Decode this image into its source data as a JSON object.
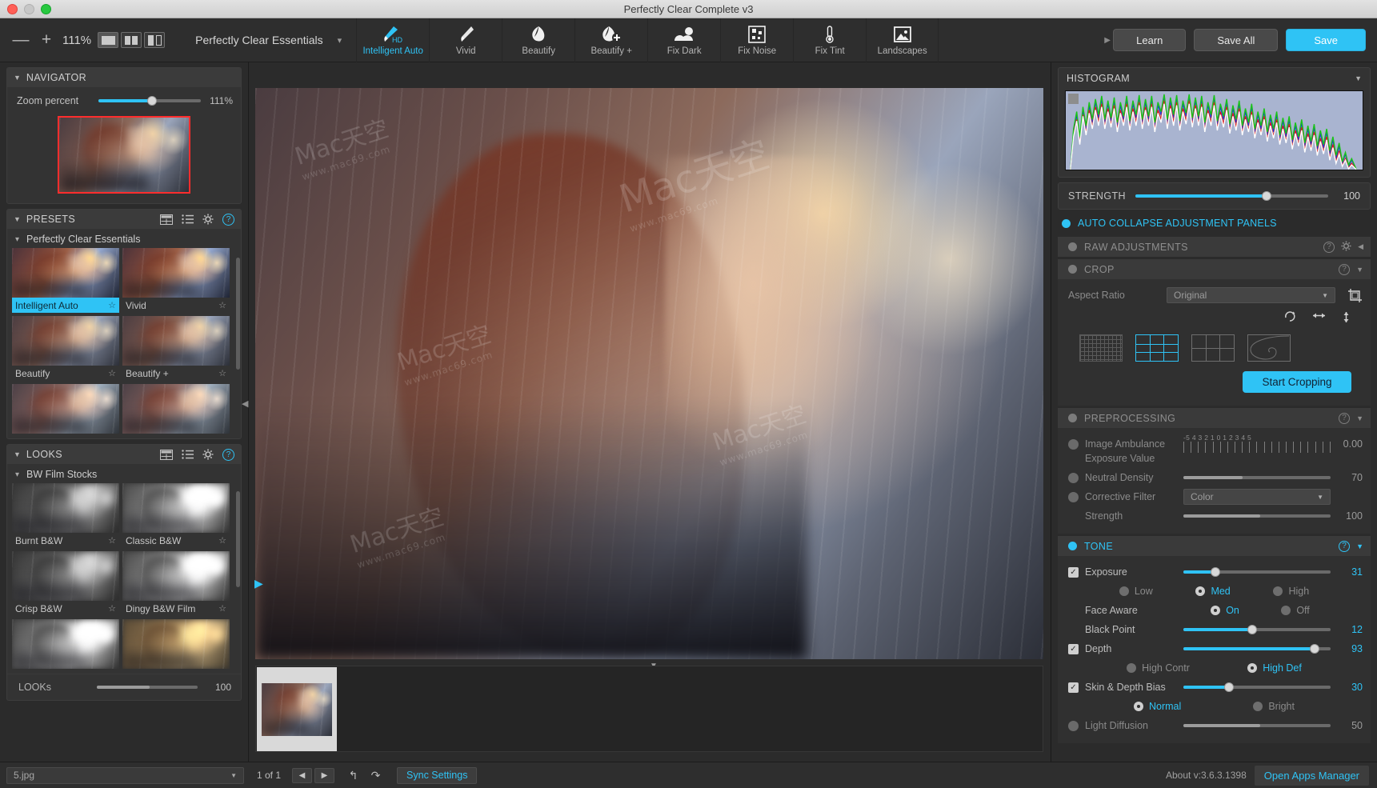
{
  "window": {
    "title": "Perfectly Clear Complete v3"
  },
  "toolbar": {
    "zoom_out": "—",
    "zoom_in": "+",
    "zoom_percent": "111%",
    "preset_name": "Perfectly Clear Essentials",
    "tools": [
      {
        "label": "Intelligent Auto",
        "icon": "brush-hd-icon",
        "badge": "HD",
        "active": true
      },
      {
        "label": "Vivid",
        "icon": "brush-icon",
        "active": false
      },
      {
        "label": "Beautify",
        "icon": "face-icon",
        "active": false
      },
      {
        "label": "Beautify +",
        "icon": "face-plus-icon",
        "active": false
      },
      {
        "label": "Fix Dark",
        "icon": "clouds-icon",
        "active": false
      },
      {
        "label": "Fix Noise",
        "icon": "noise-icon",
        "active": false
      },
      {
        "label": "Fix Tint",
        "icon": "thermometer-icon",
        "active": false
      },
      {
        "label": "Landscapes",
        "icon": "landscape-icon",
        "active": false
      }
    ],
    "learn_label": "Learn",
    "save_all_label": "Save All",
    "save_label": "Save"
  },
  "navigator": {
    "title": "NAVIGATOR",
    "zoom_label": "Zoom percent",
    "zoom_value": "111%"
  },
  "presets": {
    "title": "PRESETS",
    "group": "Perfectly Clear Essentials",
    "items": [
      {
        "label": "Intelligent Auto",
        "selected": true,
        "style": "vivid"
      },
      {
        "label": "Vivid",
        "selected": false,
        "style": "vivid"
      },
      {
        "label": "Beautify",
        "selected": false,
        "style": ""
      },
      {
        "label": "Beautify +",
        "selected": false,
        "style": ""
      },
      {
        "label": "",
        "selected": false,
        "style": "cool"
      },
      {
        "label": "",
        "selected": false,
        "style": "cool"
      }
    ]
  },
  "looks": {
    "title": "LOOKS",
    "group": "BW Film Stocks",
    "items": [
      {
        "label": "Burnt B&W",
        "style": "bw"
      },
      {
        "label": "Classic B&W",
        "style": "bw2"
      },
      {
        "label": "Crisp B&W",
        "style": "bw2"
      },
      {
        "label": "Dingy B&W Film",
        "style": "sepia"
      },
      {
        "label": "",
        "style": "bw2"
      },
      {
        "label": "",
        "style": "sepia"
      }
    ],
    "footer_label": "LOOKs",
    "footer_value": "100"
  },
  "histogram": {
    "title": "HISTOGRAM"
  },
  "strength": {
    "label": "STRENGTH",
    "value": "100"
  },
  "auto_collapse": {
    "label": "AUTO COLLAPSE ADJUSTMENT PANELS"
  },
  "panels": {
    "raw_adjustments": {
      "title": "RAW ADJUSTMENTS",
      "enabled": false
    },
    "crop": {
      "title": "CROP",
      "enabled": false,
      "aspect_ratio_label": "Aspect Ratio",
      "aspect_ratio_value": "Original",
      "start_cropping_label": "Start Cropping",
      "icons": [
        "rotate-icon",
        "flip-horizontal-icon",
        "flip-vertical-icon"
      ],
      "overlays": [
        "grid-dense-icon",
        "grid-thirds-icon",
        "grid-quarters-icon",
        "golden-spiral-icon"
      ],
      "selected_overlay": 1
    },
    "preprocessing": {
      "title": "PREPROCESSING",
      "enabled": false,
      "rows": [
        {
          "name": "Image Ambulance",
          "type": "checkbox",
          "checked": false
        },
        {
          "name": "Exposure Value",
          "type": "ticks",
          "scale": "-5  4  3  2  1  0  1  2  3  4  5",
          "value": "0.00"
        },
        {
          "name": "Neutral Density",
          "type": "slider",
          "checked": false,
          "value": "70",
          "fill": 0.4
        },
        {
          "name": "Corrective Filter",
          "type": "select",
          "checked": false,
          "value": "Color"
        },
        {
          "name": "Strength",
          "type": "slider",
          "checked": null,
          "value": "100",
          "fill": 0.52
        }
      ]
    },
    "tone": {
      "title": "TONE",
      "enabled": true,
      "rows": [
        {
          "name": "Exposure",
          "type": "slider",
          "checked": true,
          "value": "31",
          "fill": 0.22
        },
        {
          "type": "radios",
          "options": [
            {
              "label": "Low",
              "on": false
            },
            {
              "label": "Med",
              "on": true
            },
            {
              "label": "High",
              "on": false
            }
          ]
        },
        {
          "name": "Face Aware",
          "type": "radios2",
          "options": [
            {
              "label": "On",
              "on": true
            },
            {
              "label": "Off",
              "on": false
            }
          ]
        },
        {
          "name": "Black Point",
          "type": "slider",
          "checked": null,
          "value": "12",
          "fill": 0.47
        },
        {
          "name": "Depth",
          "type": "slider",
          "checked": true,
          "value": "93",
          "fill": 0.89
        },
        {
          "type": "radios",
          "options": [
            {
              "label": "High Contr",
              "on": false
            },
            {
              "label": "High Def",
              "on": true
            }
          ]
        },
        {
          "name": "Skin & Depth Bias",
          "type": "slider",
          "checked": true,
          "value": "30",
          "fill": 0.31
        },
        {
          "type": "radios",
          "options": [
            {
              "label": "Normal",
              "on": true
            },
            {
              "label": "Bright",
              "on": false
            }
          ]
        },
        {
          "name": "Light Diffusion",
          "type": "slider",
          "checked": false,
          "value": "50",
          "fill": 0.52
        }
      ]
    }
  },
  "statusbar": {
    "filename": "5.jpg",
    "page_count": "1 of 1",
    "sync_label": "Sync Settings",
    "about": "About v:3.6.3.1398",
    "apps_manager_label": "Open Apps Manager"
  }
}
